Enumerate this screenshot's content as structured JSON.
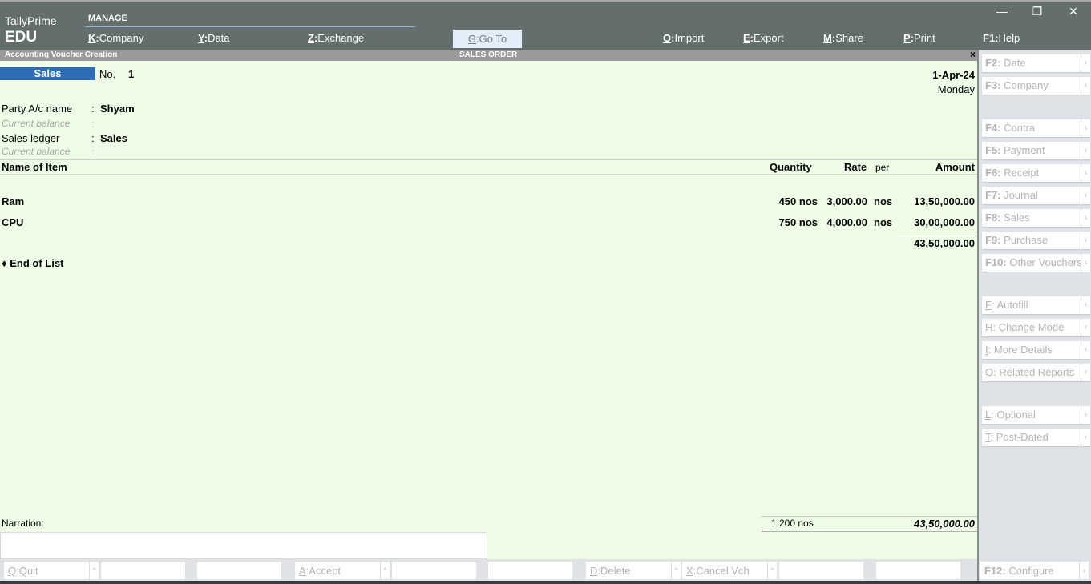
{
  "app": {
    "name": "TallyPrime",
    "edition": "EDU",
    "window_controls": {
      "minimize": "—",
      "restore": "❐",
      "close": "✕"
    }
  },
  "topbar": {
    "section_label": "MANAGE",
    "menu": [
      {
        "key": "K",
        "label": "Company"
      },
      {
        "key": "Y",
        "label": "Data"
      },
      {
        "key": "Z",
        "label": "Exchange"
      },
      {
        "key": "G",
        "label": "Go To"
      },
      {
        "key": "O",
        "label": "Import"
      },
      {
        "key": "E",
        "label": "Export"
      },
      {
        "key": "M",
        "label": "Share"
      },
      {
        "key": "P",
        "label": "Print"
      },
      {
        "key": "F1",
        "label": "Help"
      }
    ]
  },
  "title_strip": {
    "screen": "Accounting Voucher Creation",
    "voucher_title": "SALES ORDER",
    "close": "×"
  },
  "voucher": {
    "type": "Sales",
    "no_label": "No.",
    "no_value": "1",
    "date": "1-Apr-24",
    "day": "Monday",
    "fields": [
      {
        "label": "Party A/c name",
        "value": "Shyam"
      },
      {
        "label": "Current balance",
        "value": ""
      },
      {
        "label": "Sales ledger",
        "value": "Sales"
      },
      {
        "label": "Current balance",
        "value": ""
      }
    ],
    "colon": ":"
  },
  "items_table": {
    "headers": {
      "name": "Name of Item",
      "quantity": "Quantity",
      "rate": "Rate",
      "per": "per",
      "amount": "Amount"
    },
    "rows": [
      {
        "name": "Ram",
        "quantity": "450 nos",
        "rate": "3,000.00",
        "per": "nos",
        "amount": "13,50,000.00"
      },
      {
        "name": "CPU",
        "quantity": "750 nos",
        "rate": "4,000.00",
        "per": "nos",
        "amount": "30,00,000.00"
      }
    ],
    "subtotal": "43,50,000.00",
    "end_of_list": "♦ End of List"
  },
  "footer": {
    "narration_label": "Narration:",
    "narration_value": "",
    "total_quantity": "1,200 nos",
    "total_amount": "43,50,000.00"
  },
  "right_panel": [
    {
      "key": "F2",
      "label": "Date",
      "underline": false
    },
    {
      "key": "F3",
      "label": "Company",
      "underline": false
    },
    {
      "key": "F4",
      "label": "Contra",
      "underline": false
    },
    {
      "key": "F5",
      "label": "Payment",
      "underline": false
    },
    {
      "key": "F6",
      "label": "Receipt",
      "underline": false
    },
    {
      "key": "F7",
      "label": "Journal",
      "underline": false
    },
    {
      "key": "F8",
      "label": "Sales",
      "underline": false
    },
    {
      "key": "F9",
      "label": "Purchase",
      "underline": false
    },
    {
      "key": "F10",
      "label": "Other Vouchers",
      "underline": false
    },
    {
      "key": "F",
      "label": "Autofill",
      "underline": true
    },
    {
      "key": "H",
      "label": "Change Mode",
      "underline": true
    },
    {
      "key": "I",
      "label": "More Details",
      "underline": true
    },
    {
      "key": "O",
      "label": "Related Reports",
      "underline": true
    },
    {
      "key": "L",
      "label": "Optional",
      "underline": true
    },
    {
      "key": "T",
      "label": "Post-Dated",
      "underline": true
    }
  ],
  "bottom_bar": [
    {
      "key": "Q",
      "label": "Quit"
    },
    {
      "key": "",
      "label": ""
    },
    {
      "key": "",
      "label": ""
    },
    {
      "key": "A",
      "label": "Accept"
    },
    {
      "key": "",
      "label": ""
    },
    {
      "key": "",
      "label": ""
    },
    {
      "key": "D",
      "label": "Delete"
    },
    {
      "key": "X",
      "label": "Cancel Vch"
    },
    {
      "key": "",
      "label": ""
    },
    {
      "key": "",
      "label": ""
    },
    {
      "key": "F12",
      "label": "Configure"
    }
  ],
  "icons": {
    "arrow_left": "‹",
    "arrow_up": "^"
  }
}
